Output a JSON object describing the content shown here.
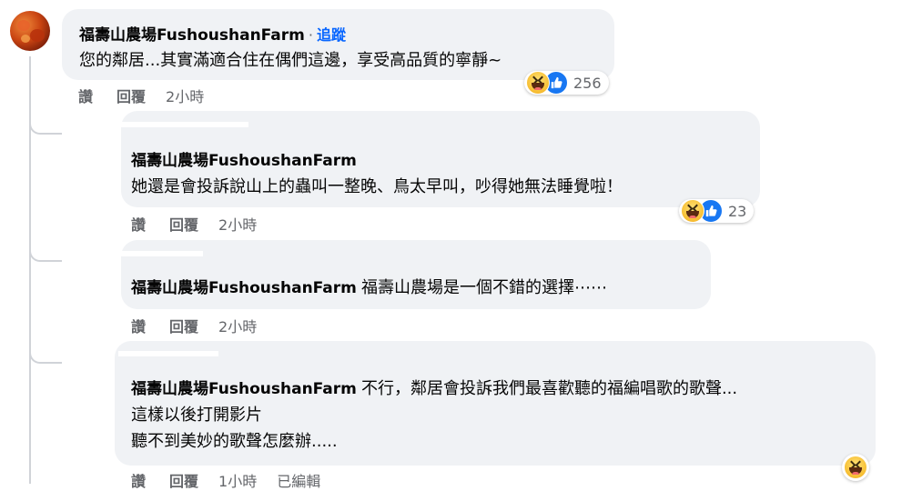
{
  "comment": {
    "author": "福壽山農場FushoushanFarm",
    "separator": "·",
    "follow_label": "追蹤",
    "text": "您的鄰居...其實滿適合住在偶們這邊，享受高品質的寧靜~",
    "actions": {
      "like": "讚",
      "reply": "回覆",
      "time": "2小時"
    },
    "reaction_count": "256",
    "reactions": [
      "haha-icon",
      "like-icon"
    ]
  },
  "replies": [
    {
      "author": "福壽山農場FushoushanFarm",
      "lines": [
        "她還是會投訴說山上的蟲叫一整晚、鳥太早叫，吵得她無法睡覺啦！"
      ],
      "actions": {
        "like": "讚",
        "reply": "回覆",
        "time": "2小時"
      },
      "reaction_count": "23"
    },
    {
      "author": "福壽山農場FushoushanFarm",
      "lines": [
        "福壽山農場是一個不錯的選擇⋯⋯"
      ],
      "actions": {
        "like": "讚",
        "reply": "回覆",
        "time": "2小時"
      },
      "reaction_count": ""
    },
    {
      "author": "福壽山農場FushoushanFarm",
      "lines": [
        "不行，鄰居會投訴我們最喜歡聽的福編唱歌的歌聲...",
        "這樣以後打開影片",
        "聽不到美妙的歌聲怎麼辦....."
      ],
      "actions": {
        "like": "讚",
        "reply": "回覆",
        "time": "1小時",
        "edited": "已編輯"
      },
      "reaction_count": ""
    }
  ],
  "colors": {
    "bubble": "#f0f2f5",
    "link": "#0866ff",
    "meta": "#65676b",
    "like_blue": "#1877f2"
  }
}
